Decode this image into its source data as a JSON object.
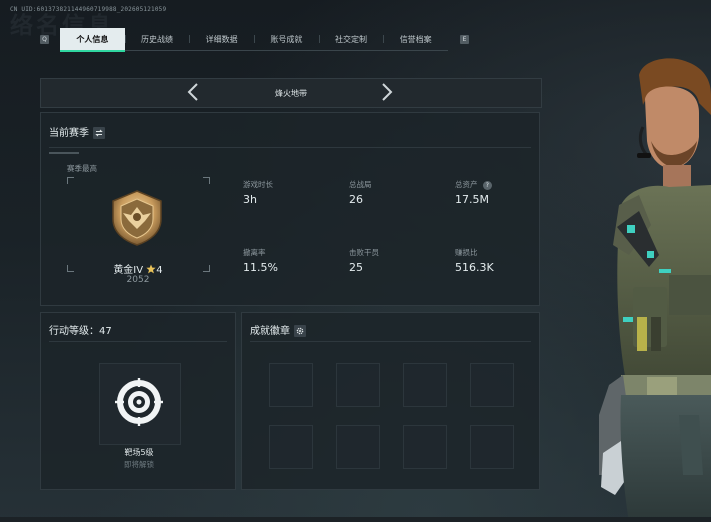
{
  "uid_text": "CN UID:601373821144960719988_202605121059",
  "watermark_text": "络名信息",
  "tabs": [
    {
      "label": "个人信息",
      "active": true
    },
    {
      "label": "历史战绩",
      "active": false
    },
    {
      "label": "详细数据",
      "active": false
    },
    {
      "label": "账号成就",
      "active": false
    },
    {
      "label": "社交定制",
      "active": false
    },
    {
      "label": "信誉档案",
      "active": false
    }
  ],
  "tab_nav": {
    "left_key": "Q",
    "right_key": "E"
  },
  "map_selector": {
    "name": "烽火地带"
  },
  "season": {
    "title": "当前赛季",
    "best_label": "赛季最高",
    "rank_name": "黄金IV",
    "rank_stars": "4",
    "rank_score": "2052",
    "stats": [
      {
        "label": "游戏时长",
        "value": "3h"
      },
      {
        "label": "总战局",
        "value": "26"
      },
      {
        "label": "总资产",
        "value": "17.5M",
        "help": "?"
      },
      {
        "label": "撤离率",
        "value": "11.5%"
      },
      {
        "label": "击败干员",
        "value": "25"
      },
      {
        "label": "赚损比",
        "value": "516.3K"
      }
    ]
  },
  "action_level": {
    "title": "行动等级：47",
    "item_name": "靶场5级",
    "item_status": "即将解锁"
  },
  "achievements": {
    "title": "成就徽章"
  },
  "colors": {
    "accent": "#30d7a0",
    "medal": "#c79a5c",
    "star": "#e8c25a"
  }
}
